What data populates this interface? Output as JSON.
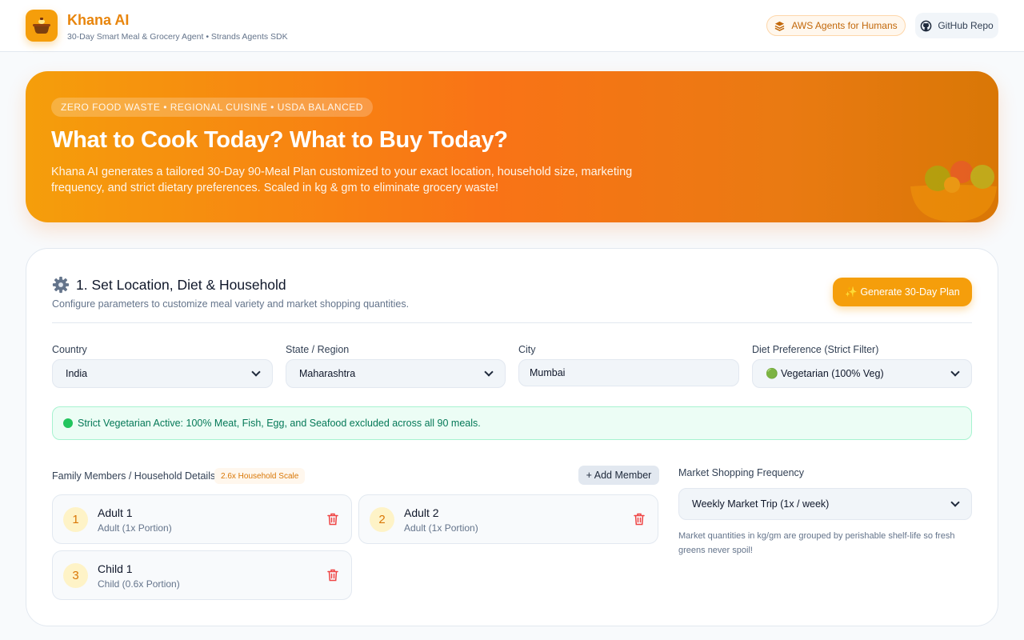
{
  "header": {
    "app_title": "Khana AI",
    "app_subtitle": "30-Day Smart Meal & Grocery Agent • Strands Agents SDK",
    "logo_icon": "cooking-pot-icon",
    "aws_button_label": "AWS Agents for Humans",
    "github_button_label": "GitHub Repo"
  },
  "hero": {
    "badge": "ZERO FOOD WASTE • REGIONAL CUISINE • USDA BALANCED",
    "title": "What to Cook Today? What to Buy Today?",
    "description": "Khana AI generates a tailored 30-Day 90-Meal Plan customized to your exact location, household size, marketing frequency, and strict dietary preferences. Scaled in kg & gm to eliminate grocery waste!"
  },
  "settings": {
    "title": "1. Set Location, Diet & Household",
    "subtitle": "Configure parameters to customize meal variety and market shopping quantities.",
    "generate_button": "✨ Generate 30-Day Plan",
    "country": {
      "label": "Country",
      "value": "India"
    },
    "state": {
      "label": "State / Region",
      "value": "Maharashtra"
    },
    "city": {
      "label": "City",
      "value": "Mumbai"
    },
    "diet": {
      "label": "Diet Preference (Strict Filter)",
      "value": "🟢 Vegetarian (100% Veg)"
    },
    "notice": "Strict Vegetarian Active: 100% Meat, Fish, Egg, and Seafood excluded across all 90 meals.",
    "family_label": "Family Members / Household Details",
    "scale_badge": "2.6x Household Scale",
    "add_member_button": "+ Add Member",
    "members": [
      {
        "num": "1",
        "name": "Adult 1",
        "portion": "Adult (1x Portion)"
      },
      {
        "num": "2",
        "name": "Adult 2",
        "portion": "Adult (1x Portion)"
      },
      {
        "num": "3",
        "name": "Child 1",
        "portion": "Child (0.6x Portion)"
      }
    ],
    "frequency": {
      "label": "Market Shopping Frequency",
      "value": "Weekly Market Trip (1x / week)",
      "note": "Market quantities in kg/gm are grouped by perishable shelf-life so fresh greens never spoil!"
    }
  },
  "colors": {
    "accent": "#f59e0b",
    "hero_orange": "#f97316",
    "success": "#047857",
    "danger": "#ef4444"
  }
}
